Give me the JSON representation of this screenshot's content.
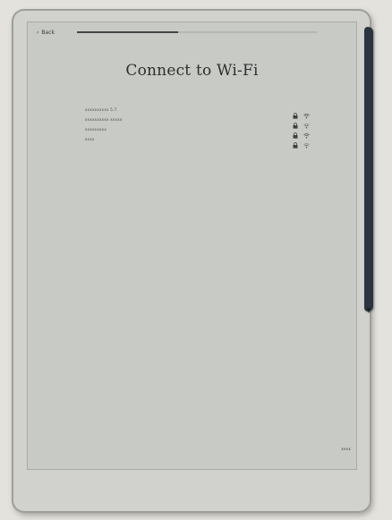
{
  "topbar": {
    "back_label": "Back",
    "setup_progress": 0.42
  },
  "title": "Connect to Wi-Fi",
  "networks": [
    {
      "name": "xxxxxxxxxx 5.7",
      "secured": true,
      "signal": "strong"
    },
    {
      "name": "xxxxxxxxxx xxxxx",
      "secured": true,
      "signal": "medium"
    },
    {
      "name": "xxxxxxxxx",
      "secured": true,
      "signal": "strong"
    },
    {
      "name": "xxxx",
      "secured": true,
      "signal": "medium"
    }
  ],
  "footer": {
    "next_label": "xxxx"
  },
  "icons": {
    "back": "chevron-left-icon",
    "lock": "lock-icon",
    "wifi": "wifi-icon"
  },
  "colors": {
    "screen": "#c8cac6",
    "ink": "#2e302f",
    "pen": "#2c3441"
  }
}
